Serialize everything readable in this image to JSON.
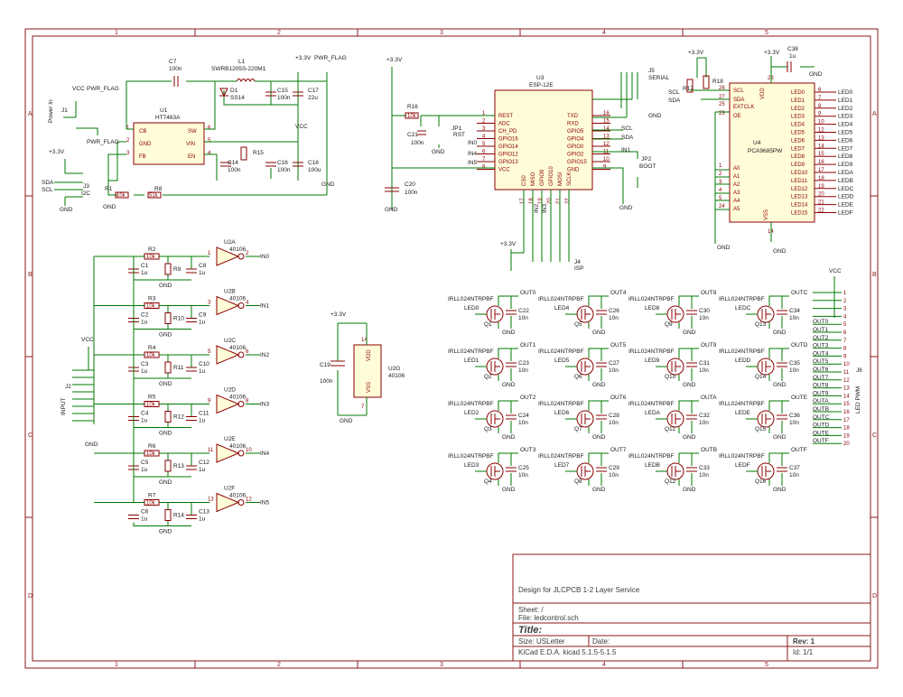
{
  "zones": {
    "cols": [
      "1",
      "2",
      "3",
      "4",
      "5"
    ],
    "rows": [
      "A",
      "B",
      "C",
      "D"
    ]
  },
  "title_block": {
    "comment": "Design for JLCPCB 1-2 Layer Service",
    "sheet": "Sheet: /",
    "file": "File: ledcontrol.sch",
    "title": "Title:",
    "size": "Size: USLetter",
    "date": "Date:",
    "rev": "Rev: 1",
    "tool": "KiCad E.D.A.  kicad 5.1.5-5.1.5",
    "id": "Id: 1/1"
  },
  "power": {
    "regulator": {
      "ref": "U1",
      "value": "HT7463A",
      "pins": {
        "cb": "CB",
        "gnd": "GND",
        "fb": "FB",
        "sw": "SW",
        "vin": "VIN",
        "en": "EN"
      },
      "pin_numbers": {
        "cb": "1",
        "gnd": "2",
        "fb": "3",
        "sw": "6",
        "vin": "5",
        "en": "4"
      }
    },
    "inductor": {
      "ref": "L1",
      "value": "SWRB1205S-220M1"
    },
    "diode": {
      "ref": "D1",
      "value": "SS14"
    },
    "caps": [
      {
        "ref": "C7",
        "value": "100n"
      },
      {
        "ref": "C15",
        "value": "100n"
      },
      {
        "ref": "C17",
        "value": "22u"
      },
      {
        "ref": "C14",
        "value": "100n"
      },
      {
        "ref": "C16",
        "value": "100n"
      },
      {
        "ref": "C18",
        "value": "100u"
      }
    ],
    "resistors": [
      {
        "ref": "R1",
        "value": "10k"
      },
      {
        "ref": "R8",
        "value": "51k"
      },
      {
        "ref": "R15",
        "value": ""
      }
    ],
    "labels": {
      "vcc": "VCC",
      "pwr_flag": "PWR_FLAG",
      "v33": "+3.3V",
      "gnd": "GND"
    },
    "connectors": {
      "j1": {
        "ref": "J1",
        "name": "Power In"
      },
      "j3": {
        "ref": "J3",
        "name": "I2C",
        "pins": [
          "SDA",
          "SCL"
        ]
      }
    }
  },
  "esp": {
    "ref": "U3",
    "value": "ESP-12E",
    "left_pins": [
      "REST",
      "ADC",
      "CH_PD",
      "GPIO16",
      "GPIO14",
      "GPIO12",
      "GPIO13",
      "VCC"
    ],
    "left_nums": [
      "1",
      "2",
      "3",
      "4",
      "5",
      "6",
      "7",
      "8"
    ],
    "right_pins": [
      "TXD",
      "RXD",
      "GPIO5",
      "GPIO4",
      "GPIO0",
      "GPIO2",
      "GPIO15",
      "GND"
    ],
    "right_nums": [
      "16",
      "15",
      "14",
      "13",
      "12",
      "11",
      "10",
      "9"
    ],
    "bottom_pins": [
      "CS0",
      "MISO",
      "GPIO9",
      "GPIO10",
      "MOSI",
      "SCLK"
    ],
    "bottom_nums": [
      "17",
      "18",
      "19",
      "20",
      "21",
      "22"
    ],
    "net_labels": {
      "in0": "IN0",
      "in4": "IN4",
      "in5": "IN5",
      "in1": "IN1",
      "scl": "SCL",
      "sda": "SDA",
      "in2": "IN2",
      "in3": "IN3"
    },
    "r16": {
      "ref": "R16",
      "value": "10k"
    },
    "c21": {
      "ref": "C21",
      "value": "100n"
    },
    "c20": {
      "ref": "C20",
      "value": "100n"
    },
    "jp1": {
      "ref": "JP1",
      "name": "RST"
    },
    "jp2": {
      "ref": "JP2",
      "name": "BOOT"
    },
    "j5": {
      "ref": "J5",
      "name": "SERIAL"
    },
    "j4": {
      "ref": "J4",
      "name": "ISP"
    }
  },
  "pwm": {
    "ref": "U4",
    "value": "PCA9685PW",
    "left_pins": [
      "SCL",
      "SDA",
      "EXTCLK",
      "OE",
      "A0",
      "A1",
      "A2",
      "A3",
      "A4",
      "A5"
    ],
    "left_nums": [
      "26",
      "27",
      "25",
      "23",
      "1",
      "2",
      "3",
      "4",
      "5",
      "24"
    ],
    "right_pins": [
      "LED0",
      "LED1",
      "LED2",
      "LED3",
      "LED4",
      "LED5",
      "LED6",
      "LED7",
      "LED8",
      "LED9",
      "LED10",
      "LED11",
      "LED12",
      "LED13",
      "LED14",
      "LED15"
    ],
    "right_nums": [
      "6",
      "7",
      "8",
      "9",
      "10",
      "12",
      "13",
      "14",
      "15",
      "16",
      "17",
      "18",
      "19",
      "20",
      "21",
      "22"
    ],
    "nets": [
      "LED0",
      "LED1",
      "LED2",
      "LED3",
      "LED4",
      "LED5",
      "LED6",
      "LED7",
      "LED8",
      "LED9",
      "LEDA",
      "LEDB",
      "LEDC",
      "LEDD",
      "LEDE",
      "LEDF"
    ],
    "vdd": "VDD",
    "vss": "VSS",
    "vdd_num": "28",
    "vss_num": "14",
    "r17": {
      "ref": "R17"
    },
    "r18": {
      "ref": "R18"
    },
    "c38": {
      "ref": "C38",
      "value": "1u"
    }
  },
  "inputs": {
    "connector": {
      "ref": "J2",
      "name": "INPUT"
    },
    "channels": [
      {
        "rin": "R2",
        "rv": "10k",
        "rb": "R9",
        "ca": "C1",
        "cb": "C8",
        "cv": "1u",
        "buf": "U2A",
        "bv": "40106",
        "net": "IN0",
        "pin_in": "1",
        "pin_out": "2"
      },
      {
        "rin": "R3",
        "rv": "10k",
        "rb": "R10",
        "ca": "C2",
        "cb": "C9",
        "cv": "1u",
        "buf": "U2B",
        "bv": "40106",
        "net": "IN1",
        "pin_in": "3",
        "pin_out": "4"
      },
      {
        "rin": "R4",
        "rv": "10k",
        "rb": "R11",
        "ca": "C3",
        "cb": "C10",
        "cv": "1u",
        "buf": "U2C",
        "bv": "40106",
        "net": "IN2",
        "pin_in": "5",
        "pin_out": "6"
      },
      {
        "rin": "R5",
        "rv": "10k",
        "rb": "R12",
        "ca": "C4",
        "cb": "C11",
        "cv": "1u",
        "buf": "U2D",
        "bv": "40106",
        "net": "IN3",
        "pin_in": "9",
        "pin_out": "8"
      },
      {
        "rin": "R6",
        "rv": "10k",
        "rb": "R13",
        "ca": "C5",
        "cb": "C12",
        "cv": "1u",
        "buf": "U2E",
        "bv": "40106",
        "net": "IN4",
        "pin_in": "11",
        "pin_out": "10"
      },
      {
        "rin": "R7",
        "rv": "10k",
        "rb": "R14",
        "ca": "C6",
        "cb": "C13",
        "cv": "1u",
        "buf": "U2F",
        "bv": "40106",
        "net": "IN5",
        "pin_in": "13",
        "pin_out": "12"
      }
    ]
  },
  "u2g": {
    "ref": "U2G",
    "value": "40106",
    "vdd": "VDD",
    "vss": "VSS",
    "pin_vdd": "14",
    "pin_vss": "7",
    "cap": {
      "ref": "C19",
      "value": "100n"
    }
  },
  "mosfets": {
    "part": "IRLL024NTRPBF",
    "cap_value": "10n",
    "rows": [
      [
        {
          "gate": "LED0",
          "out": "OUT0",
          "q": "Q1",
          "c": "C22"
        },
        {
          "gate": "LED4",
          "out": "OUT4",
          "q": "Q5",
          "c": "C26"
        },
        {
          "gate": "LED8",
          "out": "OUT8",
          "q": "Q9",
          "c": "C30"
        },
        {
          "gate": "LEDC",
          "out": "OUTC",
          "q": "Q13",
          "c": "C34"
        }
      ],
      [
        {
          "gate": "LED1",
          "out": "OUT1",
          "q": "Q2",
          "c": "C23"
        },
        {
          "gate": "LED5",
          "out": "OUT5",
          "q": "Q6",
          "c": "C27"
        },
        {
          "gate": "LED9",
          "out": "OUT9",
          "q": "Q10",
          "c": "C31"
        },
        {
          "gate": "LEDD",
          "out": "OUTD",
          "q": "Q14",
          "c": "C35"
        }
      ],
      [
        {
          "gate": "LED2",
          "out": "OUT2",
          "q": "Q3",
          "c": "C24"
        },
        {
          "gate": "LED6",
          "out": "OUT6",
          "q": "Q7",
          "c": "C28"
        },
        {
          "gate": "LEDA",
          "out": "OUTA",
          "q": "Q11",
          "c": "C32"
        },
        {
          "gate": "LEDE",
          "out": "OUTE",
          "q": "Q15",
          "c": "C36"
        }
      ],
      [
        {
          "gate": "LED3",
          "out": "OUT3",
          "q": "Q4",
          "c": "C25"
        },
        {
          "gate": "LED7",
          "out": "OUT7",
          "q": "Q8",
          "c": "C29"
        },
        {
          "gate": "LEDB",
          "out": "OUTB",
          "q": "Q12",
          "c": "C33"
        },
        {
          "gate": "LEDF",
          "out": "OUTF",
          "q": "Q16",
          "c": "C37"
        }
      ]
    ]
  },
  "led_conn": {
    "ref": "J6",
    "name": "LED PWM",
    "vcc": "VCC",
    "nets": [
      "",
      "",
      "",
      "",
      "OUT0",
      "OUT1",
      "OUT2",
      "OUT3",
      "OUT4",
      "OUT5",
      "OUT6",
      "OUT7",
      "OUT8",
      "OUT9",
      "OUTA",
      "OUTB",
      "OUTC",
      "OUTD",
      "OUTE",
      "OUTF"
    ]
  }
}
